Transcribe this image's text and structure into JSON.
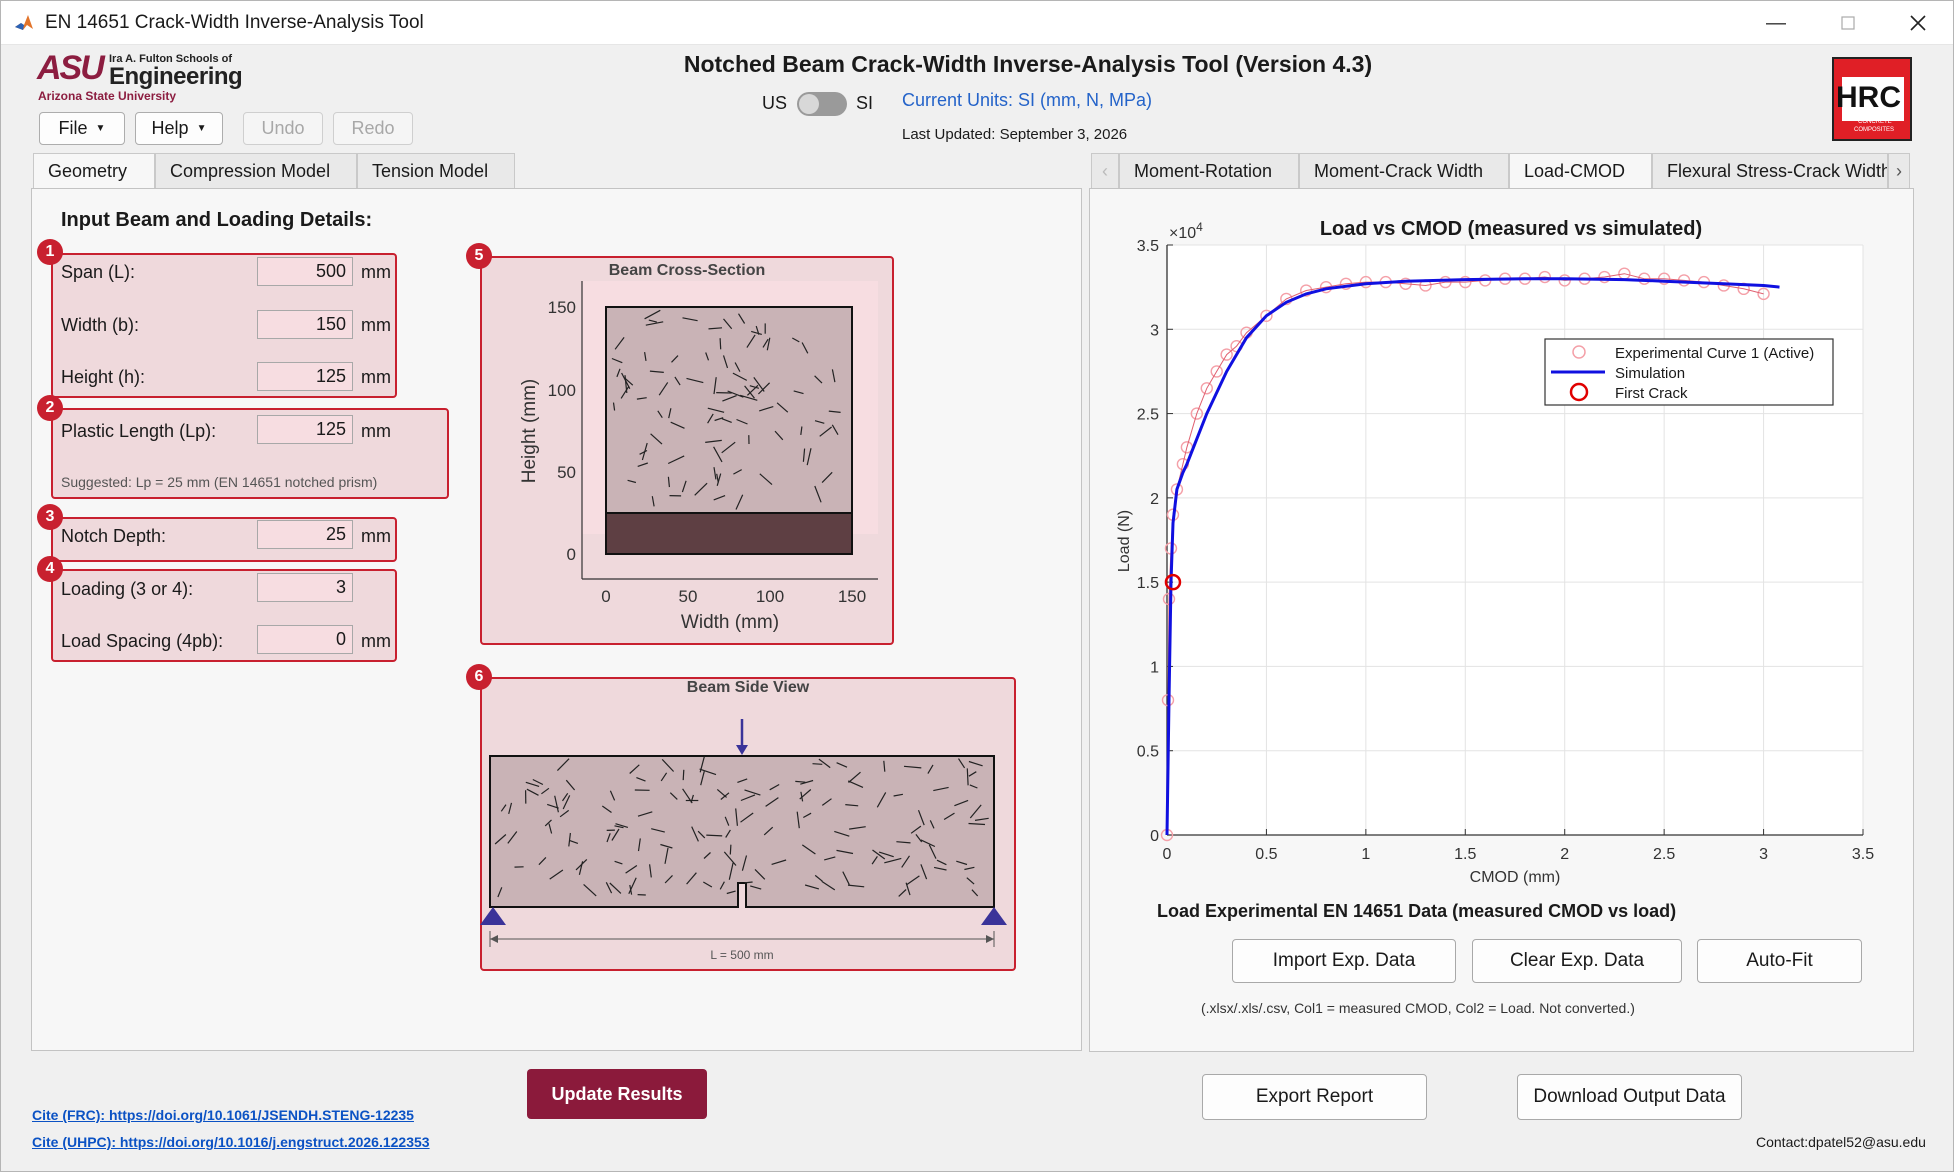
{
  "window": {
    "title": "EN 14651 Crack-Width Inverse-Analysis Tool"
  },
  "header": {
    "logo_school_line": "Ira A. Fulton Schools of",
    "logo_asu": "ASU",
    "logo_engineering": "Engineering",
    "logo_university": "Arizona State University",
    "app_title": "Notched Beam Crack-Width Inverse-Analysis Tool (Version 4.3)",
    "units_us": "US",
    "units_si": "SI",
    "current_units": "Current Units: SI (mm, N, MPa)",
    "last_updated": "Last Updated: September 3, 2026",
    "hrc_logo_text": "HRC",
    "hrc_logo_sub1": "CONCRETE",
    "hrc_logo_sub2": "COMPOSITES"
  },
  "toolbar": {
    "file": "File",
    "help": "Help",
    "undo": "Undo",
    "redo": "Redo"
  },
  "left_tabs": [
    "Geometry",
    "Compression Model",
    "Tension Model"
  ],
  "right_tabs": [
    "Moment-Rotation",
    "Moment-Crack Width",
    "Load-CMOD",
    "Flexural Stress-Crack Width"
  ],
  "geometry": {
    "heading": "Input Beam and Loading Details:",
    "span_label": "Span (L):",
    "span_value": "500",
    "span_unit": "mm",
    "width_label": "Width (b):",
    "width_value": "150",
    "width_unit": "mm",
    "height_label": "Height (h):",
    "height_value": "125",
    "height_unit": "mm",
    "lp_label": "Plastic Length (Lp):",
    "lp_value": "125",
    "lp_unit": "mm",
    "lp_hint": "Suggested: Lp = 25 mm (EN 14651 notched prism)",
    "notch_label": "Notch Depth:",
    "notch_value": "25",
    "notch_unit": "mm",
    "loading_label": "Loading (3 or 4):",
    "loading_value": "3",
    "spacing_label": "Load Spacing (4pb):",
    "spacing_value": "0",
    "spacing_unit": "mm",
    "badges": [
      "1",
      "2",
      "3",
      "4",
      "5",
      "6"
    ]
  },
  "cross_section": {
    "title": "Beam Cross-Section",
    "xlabel": "Width (mm)",
    "ylabel": "Height (mm)",
    "xticks": [
      "0",
      "50",
      "100",
      "150"
    ],
    "yticks": [
      "0",
      "50",
      "100",
      "150"
    ],
    "width_mm": 150,
    "height_mm": 125,
    "notch_mm": 25,
    "colors": {
      "beam": "#c9b3b6",
      "notch": "#5e3f43",
      "plot_bg": "#f7dde1"
    }
  },
  "side_view": {
    "title": "Beam Side View",
    "span_label": "L = 500 mm",
    "colors": {
      "support": "#3a3399",
      "load": "#3a3399"
    }
  },
  "chart": {
    "title": "Load vs CMOD (measured vs simulated)",
    "xlabel": "CMOD (mm)",
    "ylabel": "Load (N)",
    "exponent": "×10",
    "exponent_power": "4",
    "xticks": [
      "0",
      "0.5",
      "1",
      "1.5",
      "2",
      "2.5",
      "3",
      "3.5"
    ],
    "yticks": [
      "0",
      "0.5",
      "1",
      "1.5",
      "2",
      "2.5",
      "3",
      "3.5"
    ],
    "legend": [
      "Experimental Curve 1 (Active)",
      "Simulation",
      "First Crack"
    ]
  },
  "chart_data": {
    "type": "line",
    "title": "Load vs CMOD (measured vs simulated)",
    "xlabel": "CMOD (mm)",
    "ylabel": "Load (N)",
    "xlim": [
      0,
      3.5
    ],
    "ylim": [
      0,
      35000
    ],
    "grid": true,
    "legend_position": "top-right",
    "series": [
      {
        "name": "Experimental Curve 1 (Active)",
        "style": "circles",
        "color": "#f4a0a8",
        "x": [
          0,
          0.005,
          0.01,
          0.02,
          0.03,
          0.05,
          0.08,
          0.1,
          0.15,
          0.2,
          0.25,
          0.3,
          0.35,
          0.4,
          0.5,
          0.6,
          0.7,
          0.8,
          0.9,
          1.0,
          1.1,
          1.2,
          1.3,
          1.4,
          1.5,
          1.6,
          1.7,
          1.8,
          1.9,
          2.0,
          2.1,
          2.2,
          2.3,
          2.4,
          2.5,
          2.6,
          2.7,
          2.8,
          2.9,
          3.0
        ],
        "y": [
          0,
          8000,
          14000,
          17000,
          19000,
          20500,
          22000,
          23000,
          25000,
          26500,
          27500,
          28500,
          29000,
          29800,
          30800,
          31800,
          32300,
          32500,
          32700,
          32800,
          32800,
          32700,
          32600,
          32800,
          32800,
          32900,
          33000,
          33000,
          33100,
          32900,
          33000,
          33100,
          33300,
          33000,
          33000,
          32900,
          32800,
          32600,
          32400,
          32100
        ]
      },
      {
        "name": "Simulation",
        "style": "line",
        "color": "#1010e0",
        "x": [
          0,
          0.01,
          0.02,
          0.03,
          0.05,
          0.08,
          0.1,
          0.15,
          0.2,
          0.3,
          0.4,
          0.5,
          0.6,
          0.7,
          0.8,
          1.0,
          1.2,
          1.5,
          1.8,
          2.0,
          2.3,
          2.5,
          2.8,
          3.0,
          3.08
        ],
        "y": [
          0,
          8000,
          15000,
          18500,
          20500,
          21500,
          22000,
          23500,
          25000,
          27500,
          29500,
          30800,
          31600,
          32100,
          32400,
          32700,
          32850,
          32950,
          33000,
          33000,
          32950,
          32850,
          32700,
          32600,
          32500
        ]
      },
      {
        "name": "First Crack",
        "style": "marker",
        "color": "#e00000",
        "x": [
          0.03
        ],
        "y": [
          15000
        ]
      }
    ]
  },
  "load_section": {
    "heading": "Load Experimental EN 14651 Data (measured CMOD vs load)",
    "import": "Import Exp. Data",
    "clear": "Clear Exp. Data",
    "autofit": "Auto-Fit",
    "hint": "(.xlsx/.xls/.csv, Col1 = measured CMOD, Col2 = Load. Not converted.)"
  },
  "footer": {
    "update": "Update Results",
    "export": "Export Report",
    "download": "Download Output Data",
    "cite_frc": "Cite (FRC): https://doi.org/10.1061/JSENDH.STENG-12235",
    "cite_uhpc": "Cite (UHPC): https://doi.org/10.1016/j.engstruct.2026.122353",
    "contact": "Contact:dpatel52@asu.edu",
    "update_color": "#8b1a3b"
  }
}
